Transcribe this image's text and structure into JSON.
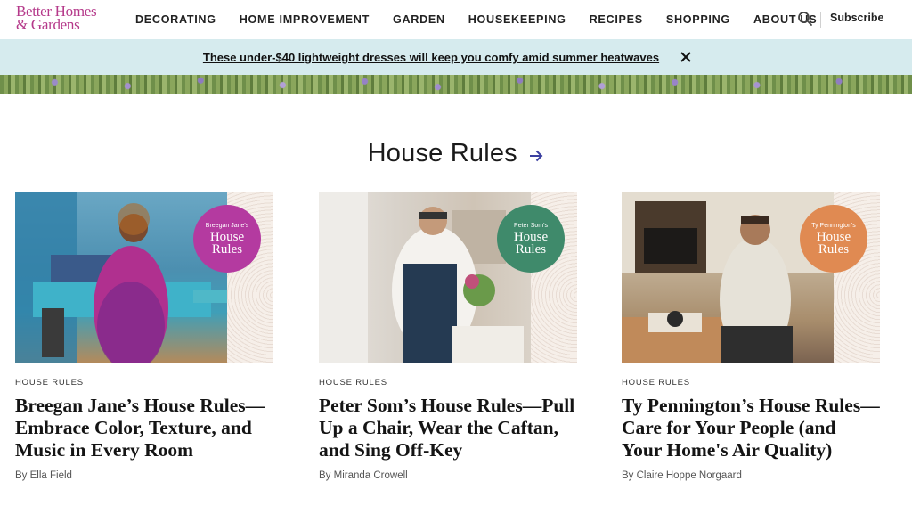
{
  "header": {
    "logo_line1": "Better Homes",
    "logo_line2": "& Gardens",
    "nav": [
      "DECORATING",
      "HOME IMPROVEMENT",
      "GARDEN",
      "HOUSEKEEPING",
      "RECIPES",
      "SHOPPING",
      "ABOUT US"
    ],
    "search_icon": "search-icon",
    "subscribe": "Subscribe"
  },
  "banner": {
    "text": "These under-$40 lightweight dresses will keep you comfy amid summer heatwaves",
    "close_icon": "close-icon"
  },
  "section": {
    "title": "House Rules",
    "arrow_icon": "arrow-right-icon"
  },
  "cards": [
    {
      "badge_who": "Breegan Jane's",
      "badge_line1": "House",
      "badge_line2": "Rules",
      "badge_color": "#b43aa0",
      "eyebrow": "HOUSE RULES",
      "headline": "Breegan Jane’s House Rules—Embrace Color, Texture, and Music in Every Room",
      "byline": "By Ella Field"
    },
    {
      "badge_who": "Peter Som's",
      "badge_line1": "House",
      "badge_line2": "Rules",
      "badge_color": "#3f8a6b",
      "eyebrow": "HOUSE RULES",
      "headline": "Peter Som’s House Rules—Pull Up a Chair, Wear the Caftan, and Sing Off-Key",
      "byline": "By Miranda Crowell"
    },
    {
      "badge_who": "Ty Pennington's",
      "badge_line1": "House",
      "badge_line2": "Rules",
      "badge_color": "#e08a52",
      "eyebrow": "HOUSE RULES",
      "headline": "Ty Pennington’s House Rules—Care for Your People (and Your Home's Air Quality)",
      "byline": "By Claire Hoppe Norgaard"
    }
  ]
}
